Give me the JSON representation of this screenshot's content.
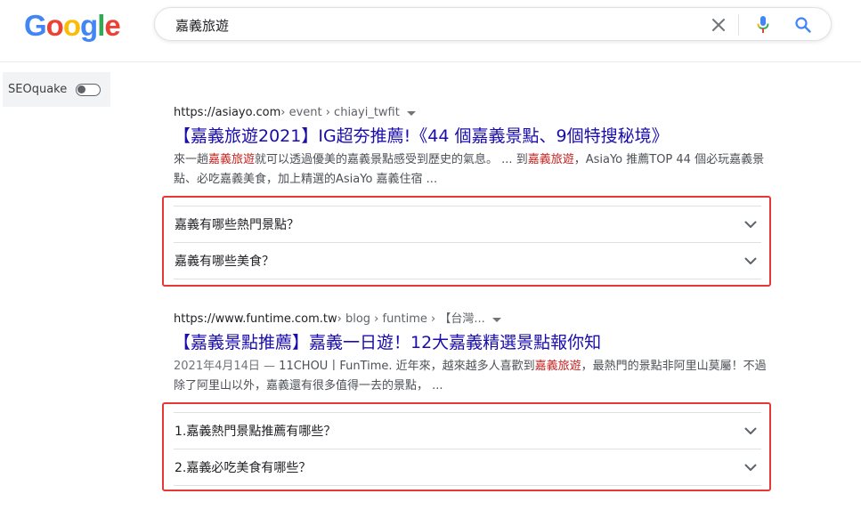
{
  "logo": {
    "letters": [
      "G",
      "o",
      "o",
      "g",
      "l",
      "e"
    ]
  },
  "search": {
    "query": "嘉義旅遊"
  },
  "icons": {
    "clear": "close-icon",
    "mic": "microphone-icon",
    "search": "magnifier-icon",
    "chevron": "chevron-down-icon"
  },
  "colors": {
    "link": "#1a0dab",
    "highlight_keyword": "#c5221f",
    "annotation_box": "#e53935"
  },
  "seoquake": {
    "label": "SEOquake",
    "enabled": false
  },
  "results": [
    {
      "cite_domain": "https://asiayo.com",
      "cite_path": " › event › chiayi_twfit",
      "title": "【嘉義旅遊2021】IG超夯推薦!《44 個嘉義景點、9個特搜秘境》",
      "snippet": {
        "date": "",
        "p1": "來一趟",
        "k1": "嘉義旅遊",
        "p2": "就可以透過優美的嘉義景點感受到歷史的氣息。 ... 到",
        "k2": "嘉義旅遊",
        "p3": "，AsiaYo 推薦TOP 44 個必玩嘉義景點、必吃嘉義美食，加上精選的AsiaYo 嘉義住宿 ..."
      },
      "questions": [
        "嘉義有哪些熱門景點？",
        "嘉義有哪些美食？"
      ]
    },
    {
      "cite_domain": "https://www.funtime.com.tw",
      "cite_path": " › blog › funtime › 【台灣...",
      "title": "【嘉義景點推薦】嘉義一日遊！12大嘉義精選景點報你知",
      "snippet": {
        "date": "2021年4月14日 — ",
        "p1": "11CHOU丨FunTime. 近年來，越來越多人喜歡到",
        "k1": "嘉義旅遊",
        "p2": "，最熱門的景點非阿里山莫屬！不過除了阿里山以外，嘉義還有很多值得一去的景點， ...",
        "k2": "",
        "p3": ""
      },
      "questions": [
        "1.嘉義熱門景點推薦有哪些？",
        "2.嘉義必吃美食有哪些？"
      ]
    }
  ]
}
